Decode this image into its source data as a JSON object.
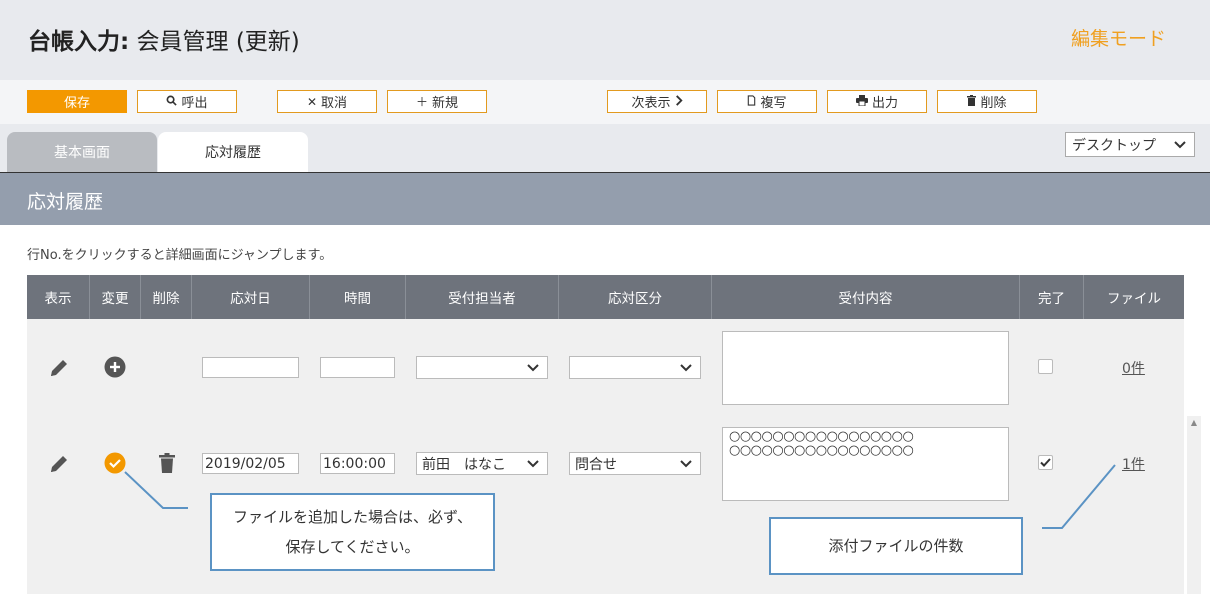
{
  "header": {
    "title_bold": "台帳入力:",
    "title_rest": "会員管理 (更新)",
    "mode": "編集モード"
  },
  "toolbar": {
    "save": "保存",
    "call": "呼出",
    "cancel": "取消",
    "new": "新規",
    "next": "次表示",
    "copy": "複写",
    "output": "出力",
    "delete": "削除"
  },
  "tabs": [
    {
      "label": "基本画面",
      "active": false
    },
    {
      "label": "応対履歴",
      "active": true
    }
  ],
  "view_select": "デスクトップ",
  "section_title": "応対履歴",
  "hint": "行No.をクリックすると詳細画面にジャンプします。",
  "table": {
    "headers": [
      "表示",
      "変更",
      "削除",
      "応対日",
      "時間",
      "受付担当者",
      "応対区分",
      "受付内容",
      "完了",
      "ファイル"
    ],
    "rows": [
      {
        "date": "",
        "time": "",
        "staff": "",
        "category": "",
        "content": "",
        "done": false,
        "files": "0件"
      },
      {
        "date": "2019/02/05",
        "time": "16:00:00",
        "staff": "前田　はなこ",
        "category": "問合せ",
        "content_line1": "○○○○○○○○○○○○○○○○○",
        "content_line2": "○○○○○○○○○○○○○○○○○",
        "done": true,
        "files": "1件"
      }
    ]
  },
  "callouts": {
    "save_note_line1": "ファイルを追加した場合は、必ず、",
    "save_note_line2": "保存してください。",
    "file_count_note": "添付ファイルの件数"
  },
  "colors": {
    "accent": "#f39800",
    "header_bg": "#e8eaee",
    "section_bg": "#949ead",
    "table_header_bg": "#6e737c",
    "callout_border": "#5b93c4"
  }
}
